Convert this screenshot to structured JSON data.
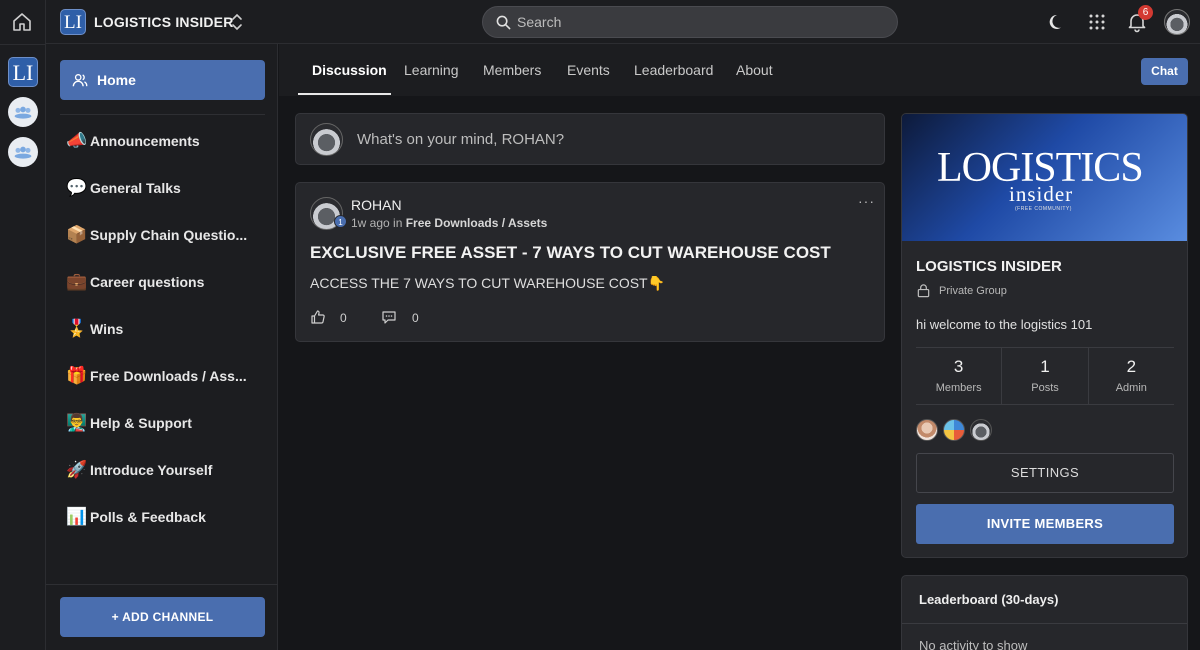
{
  "colors": {
    "accent": "#4a6eaf",
    "bg": "#151619",
    "panel": "#1c1d20",
    "card": "#26272b",
    "badge": "#d33a32"
  },
  "rail": {
    "logo_text": "LI",
    "icons": [
      "home-icon",
      "community-icon",
      "community-icon"
    ]
  },
  "topbar": {
    "brand_logo": "LI",
    "brand_name": "LOGISTICS INSIDER",
    "search_placeholder": "Search",
    "notification_count": "6",
    "icons": [
      "moon-icon",
      "apps-grid-icon",
      "bell-icon"
    ]
  },
  "sidebar": {
    "home_label": "Home",
    "channels": [
      {
        "emoji": "📣",
        "label": "Announcements"
      },
      {
        "emoji": "💬",
        "label": "General Talks"
      },
      {
        "emoji": "📦",
        "label": "Supply Chain Questio..."
      },
      {
        "emoji": "💼",
        "label": "Career questions"
      },
      {
        "emoji": "🎖️",
        "label": "Wins"
      },
      {
        "emoji": "🎁",
        "label": "Free Downloads / Ass..."
      },
      {
        "emoji": "👨‍🏫",
        "label": "Help & Support"
      },
      {
        "emoji": "🚀",
        "label": "Introduce Yourself"
      },
      {
        "emoji": "📊",
        "label": "Polls & Feedback"
      }
    ],
    "add_channel": "+ ADD CHANNEL"
  },
  "tabs": {
    "items": [
      "Discussion",
      "Learning",
      "Members",
      "Events",
      "Leaderboard",
      "About"
    ],
    "active": "Discussion",
    "chat": "Chat"
  },
  "composer": {
    "placeholder": "What's on your mind, ROHAN?"
  },
  "post": {
    "author": "ROHAN",
    "level": "1",
    "time": "1w ago in",
    "channel": "Free Downloads / Assets",
    "more": "···",
    "title": "EXCLUSIVE FREE ASSET - 7 WAYS TO CUT WAREHOUSE COST",
    "body": "ACCESS THE 7 WAYS TO CUT WAREHOUSE COST👇",
    "likes": "0",
    "comments": "0"
  },
  "group": {
    "cover_big": "LOGISTICS",
    "cover_small": "insider",
    "cover_tiny": "(FREE COMMUNITY)",
    "name": "LOGISTICS INSIDER",
    "privacy": "Private Group",
    "description": "hi welcome to the logistics 101",
    "stats": [
      {
        "value": "3",
        "label": "Members"
      },
      {
        "value": "1",
        "label": "Posts"
      },
      {
        "value": "2",
        "label": "Admin"
      }
    ],
    "settings": "SETTINGS",
    "invite": "INVITE MEMBERS"
  },
  "leaderboard": {
    "title": "Leaderboard (30-days)",
    "empty": "No activity to show"
  }
}
